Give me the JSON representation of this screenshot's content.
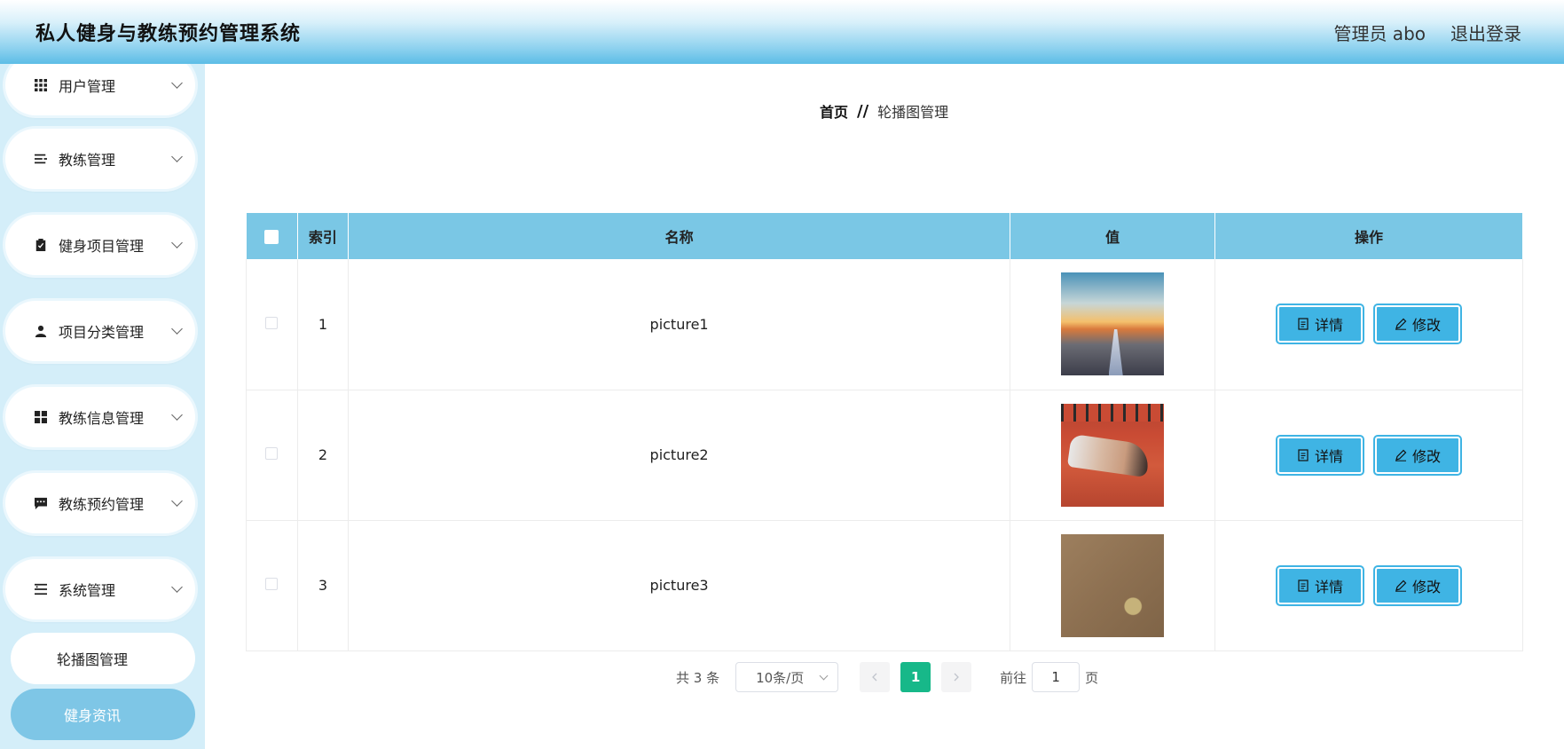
{
  "header": {
    "title": "私人健身与教练预约管理系统",
    "user": "管理员 abo",
    "logout": "退出登录"
  },
  "sidebar": {
    "items": [
      {
        "label": "用户管理",
        "icon": "grid-icon"
      },
      {
        "label": "教练管理",
        "icon": "list-icon"
      },
      {
        "label": "健身项目管理",
        "icon": "clipboard-icon"
      },
      {
        "label": "项目分类管理",
        "icon": "user-icon"
      },
      {
        "label": "教练信息管理",
        "icon": "apps-icon"
      },
      {
        "label": "教练预约管理",
        "icon": "message-icon"
      },
      {
        "label": "系统管理",
        "icon": "menu-icon"
      }
    ],
    "sub_items": [
      {
        "label": "轮播图管理"
      },
      {
        "label": "健身资讯"
      }
    ]
  },
  "breadcrumb": {
    "home": "首页",
    "separator": "//",
    "current": "轮播图管理"
  },
  "table": {
    "headers": {
      "index": "索引",
      "name": "名称",
      "value": "值",
      "actions": "操作"
    },
    "rows": [
      {
        "index": "1",
        "name": "picture1"
      },
      {
        "index": "2",
        "name": "picture2"
      },
      {
        "index": "3",
        "name": "picture3"
      }
    ],
    "detail_label": "详情",
    "edit_label": "修改"
  },
  "pagination": {
    "total": "共 3 条",
    "page_size": "10条/页",
    "current_page": "1",
    "goto_label": "前往",
    "goto_value": "1",
    "page_suffix": "页"
  },
  "colors": {
    "header_accent": "#5cbde6",
    "sidebar_bg": "#d4eef9",
    "table_header": "#7ac7e5",
    "button": "#3fb4e4",
    "active_page": "#17b889"
  }
}
